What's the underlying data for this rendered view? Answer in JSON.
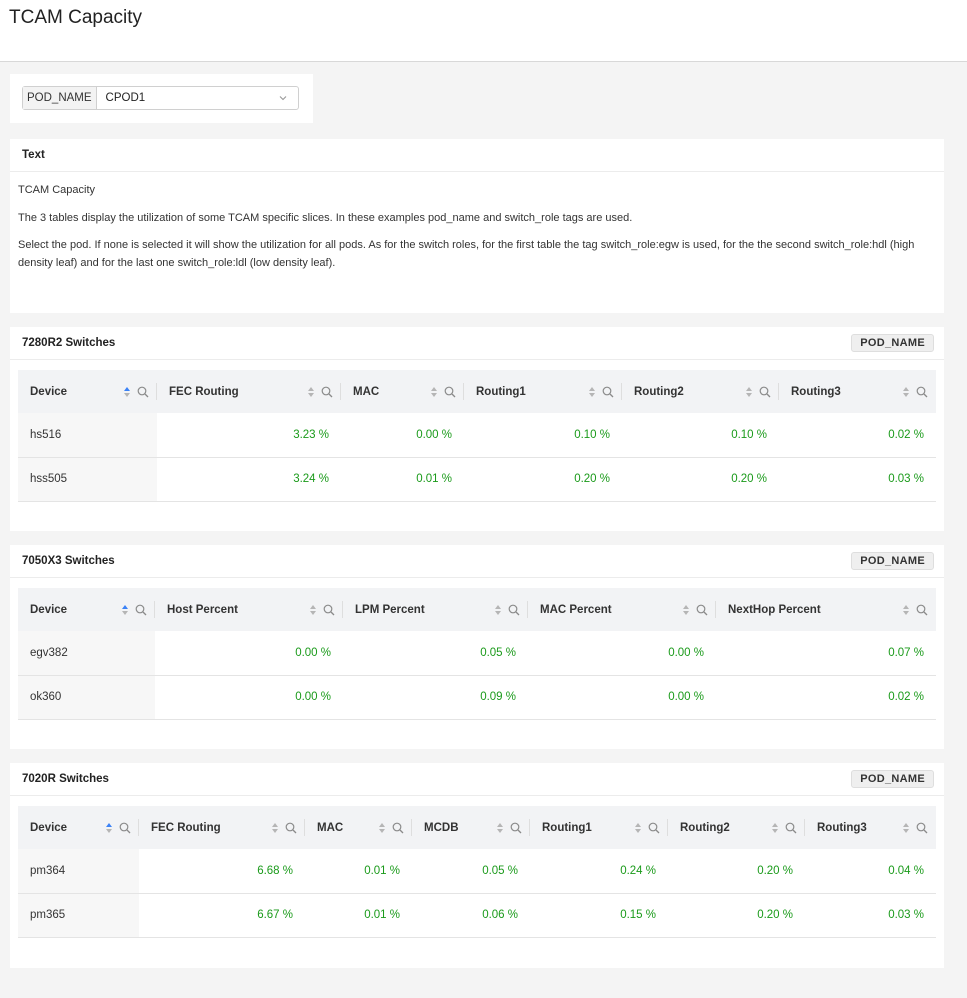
{
  "page": {
    "title": "TCAM Capacity"
  },
  "filter": {
    "label": "POD_NAME",
    "selected": "CPOD1"
  },
  "text_panel": {
    "title": "Text",
    "paragraphs": [
      "TCAM Capacity",
      "The 3 tables display the utilization of some TCAM specific slices. In these examples pod_name and switch_role tags are used.",
      "Select the pod. If none is selected it will show the utilization for all pods. As for the switch roles, for the first table the tag switch_role:egw is used, for the the second switch_role:hdl (high density leaf) and for the last one switch_role:ldl (low density leaf)."
    ]
  },
  "panels": [
    {
      "title": "7280R2 Switches",
      "tag": "POD_NAME",
      "columns": [
        "Device",
        "FEC Routing",
        "MAC",
        "Routing1",
        "Routing2",
        "Routing3"
      ],
      "rows": [
        [
          "hs516",
          "3.23 %",
          "0.00 %",
          "0.10 %",
          "0.10 %",
          "0.02 %"
        ],
        [
          "hss505",
          "3.24 %",
          "0.01 %",
          "0.20 %",
          "0.20 %",
          "0.03 %"
        ]
      ]
    },
    {
      "title": "7050X3 Switches",
      "tag": "POD_NAME",
      "columns": [
        "Device",
        "Host Percent",
        "LPM Percent",
        "MAC Percent",
        "NextHop Percent"
      ],
      "rows": [
        [
          "egv382",
          "0.00 %",
          "0.05 %",
          "0.00 %",
          "0.07 %"
        ],
        [
          "ok360",
          "0.00 %",
          "0.09 %",
          "0.00 %",
          "0.02 %"
        ]
      ]
    },
    {
      "title": "7020R Switches",
      "tag": "POD_NAME",
      "columns": [
        "Device",
        "FEC Routing",
        "MAC",
        "MCDB",
        "Routing1",
        "Routing2",
        "Routing3"
      ],
      "rows": [
        [
          "pm364",
          "6.68 %",
          "0.01 %",
          "0.05 %",
          "0.24 %",
          "0.20 %",
          "0.04 %"
        ],
        [
          "pm365",
          "6.67 %",
          "0.01 %",
          "0.06 %",
          "0.15 %",
          "0.20 %",
          "0.03 %"
        ]
      ]
    }
  ],
  "colors": {
    "value_green": "#1a9a1a",
    "sort_active": "#3b82f6",
    "sort_inactive": "#b5b5b5"
  }
}
